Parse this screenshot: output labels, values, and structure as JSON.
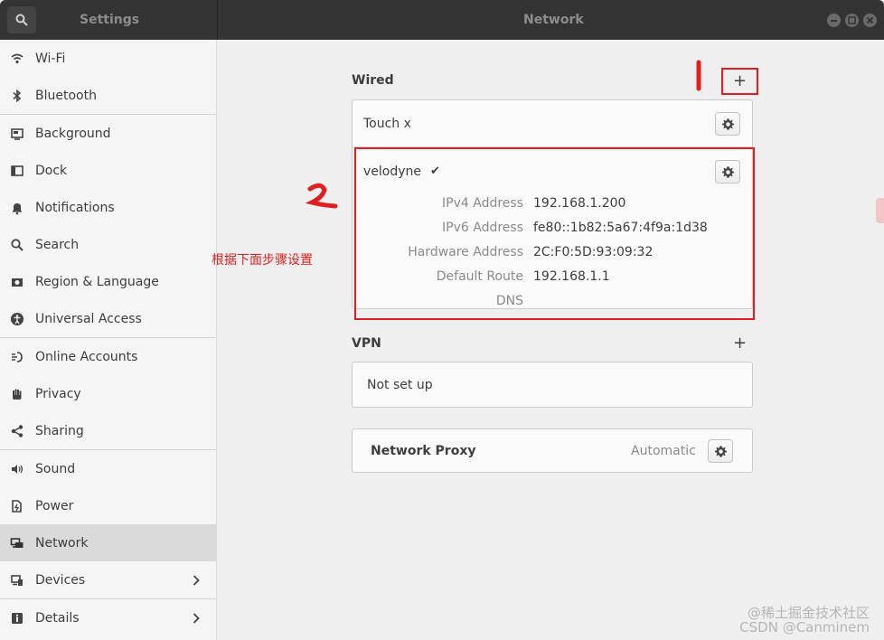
{
  "window": {
    "sidebar_title": "Settings",
    "page_title": "Network",
    "controls": [
      "minimize",
      "maximize",
      "close"
    ]
  },
  "sidebar": {
    "items": [
      {
        "label": "Wi-Fi",
        "icon": "wifi-icon"
      },
      {
        "label": "Bluetooth",
        "icon": "bluetooth-icon"
      },
      {
        "label": "Background",
        "icon": "background-icon"
      },
      {
        "label": "Dock",
        "icon": "dock-icon"
      },
      {
        "label": "Notifications",
        "icon": "bell-icon"
      },
      {
        "label": "Search",
        "icon": "search-icon"
      },
      {
        "label": "Region & Language",
        "icon": "camera-icon"
      },
      {
        "label": "Universal Access",
        "icon": "accessibility-icon"
      },
      {
        "label": "Online Accounts",
        "icon": "accounts-icon"
      },
      {
        "label": "Privacy",
        "icon": "hand-icon"
      },
      {
        "label": "Sharing",
        "icon": "share-icon"
      },
      {
        "label": "Sound",
        "icon": "speaker-icon"
      },
      {
        "label": "Power",
        "icon": "power-icon"
      },
      {
        "label": "Network",
        "icon": "network-icon",
        "active": true
      },
      {
        "label": "Devices",
        "icon": "devices-icon",
        "has_chevron": true
      },
      {
        "label": "Details",
        "icon": "details-icon",
        "has_chevron": true
      }
    ]
  },
  "wired": {
    "title": "Wired",
    "add_label": "+",
    "connections": [
      {
        "name": "Touch x"
      },
      {
        "name": "velodyne",
        "connected_mark": "✔",
        "details": [
          {
            "key": "IPv4 Address",
            "value": "192.168.1.200"
          },
          {
            "key": "IPv6 Address",
            "value": "fe80::1b82:5a67:4f9a:1d38"
          },
          {
            "key": "Hardware Address",
            "value": "2C:F0:5D:93:09:32"
          },
          {
            "key": "Default Route",
            "value": "192.168.1.1"
          },
          {
            "key": "DNS",
            "value": ""
          }
        ]
      }
    ]
  },
  "vpn": {
    "title": "VPN",
    "add_label": "+",
    "status": "Not set up"
  },
  "proxy": {
    "title": "Network Proxy",
    "status": "Automatic"
  },
  "annotations": {
    "marker_1": "1",
    "marker_2": "2",
    "instruction": "根据下面步骤设置"
  },
  "watermark": {
    "line1": "@稀土掘金技术社区",
    "line2": "CSDN @Canminem"
  },
  "colors": {
    "titlebar": "#343434",
    "sidebar_bg": "#f5f5f5",
    "active_item": "#dadada",
    "annotation_red": "#e02020"
  }
}
